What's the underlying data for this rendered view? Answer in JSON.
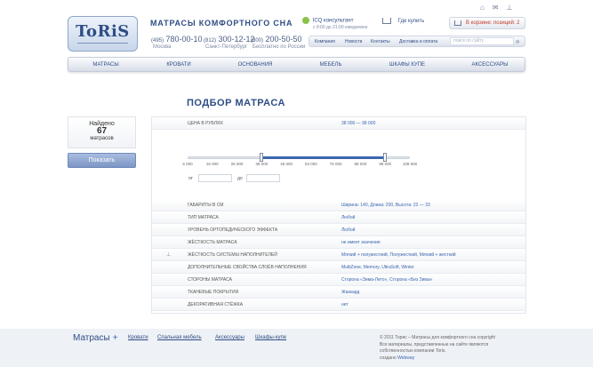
{
  "header": {
    "logo_text": "ToRiS",
    "tagline": "МАТРАСЫ КОМФОРТНОГО СНА",
    "phones": [
      {
        "code": "(495)",
        "number": "780-00-10",
        "city": "Москва"
      },
      {
        "code": "(812)",
        "number": "300-12-12",
        "city": "Санкт-Петербург"
      },
      {
        "code": "(800)",
        "number": "200-50-50",
        "city": "Бесплатно по России"
      }
    ],
    "consultant": "ICQ консультант",
    "consultant_sub": "с 9:00 до 21:00 ежедневно",
    "where_to_buy": "Где купить",
    "cart": "В корзине: позиций: 2"
  },
  "topnav": {
    "items": [
      "Компания",
      "Новости",
      "Контакты",
      "Доставка и оплата"
    ],
    "search_placeholder": "поиск по сайту"
  },
  "catnav": [
    "МАТРАСЫ",
    "КРОВАТИ",
    "ОСНОВАНИЯ",
    "МЕБЕЛЬ",
    "ШКАФЫ КУПЕ",
    "АКСЕССУАРЫ"
  ],
  "main": {
    "heading": "ПОДБОР МАТРАСА",
    "found": {
      "label": "Найдено",
      "count": "67",
      "unit": "матрасов"
    },
    "show_button": "Показать",
    "price": {
      "label": "ЦЕНА В РУБЛЯХ",
      "value": "38 000 — 98 000",
      "ticks": [
        "6 000",
        "16 000",
        "26 000",
        "38 000",
        "45 000",
        "53 000",
        "75 000",
        "88 000",
        "98 000",
        "108 000"
      ],
      "range_min": 6000,
      "range_max": 108000,
      "selected_from": 38000,
      "selected_to": 98000,
      "from_label": "от",
      "to_label": "до"
    },
    "rows": [
      {
        "label": "ГАБАРИТЫ В СМ",
        "value": "Ширина: 140, Длина: 200, Высота: 22 — 33"
      },
      {
        "label": "ТИП МАТРАСА",
        "value": "Любой"
      },
      {
        "label": "УРОВЕНЬ ОРТОПЕДИЧЕСКОГО ЭФФЕКТА",
        "value": "Любой"
      },
      {
        "label": "ЖЁСТКОСТЬ МАТРАСА",
        "value": "не имеет значения"
      },
      {
        "label": "ЖЁСТКОСТЬ СИСТЕМЫ НАПОЛНИТЕЛЕЙ",
        "value": "Мягкий + полужесткий, Полужесткий, Мягкий + жесткий"
      },
      {
        "label": "ДОПОЛНИТЕЛЬНЫЕ СВОЙСТВА СЛОЁВ НАПОЛНЕНИЯ",
        "value": "MultiZone, Memory, UltraSoft, Winter"
      },
      {
        "label": "СТОРОНЫ МАТРАСА",
        "value": "Сторона «Зима-Лето», Сторона «Без Зима»"
      },
      {
        "label": "ТКАНЕВЫЕ ПОКРЫТИЯ",
        "value": "Жаккард"
      },
      {
        "label": "ДЕКОРАТИВНАЯ СТЁЖКА",
        "value": "нет"
      }
    ]
  },
  "footer": {
    "brand": "Матрасы",
    "links": [
      "Кровати",
      "Спальная мебель",
      "Аксессуары",
      "Шкафы-купе"
    ],
    "copyright": "© 2011 Торис – Матрасы для комфортного сна copyright",
    "rights": "Все материалы, представленные на сайте являются собственностью компании Toris.",
    "made_by": "создано",
    "maker": "Webway"
  }
}
